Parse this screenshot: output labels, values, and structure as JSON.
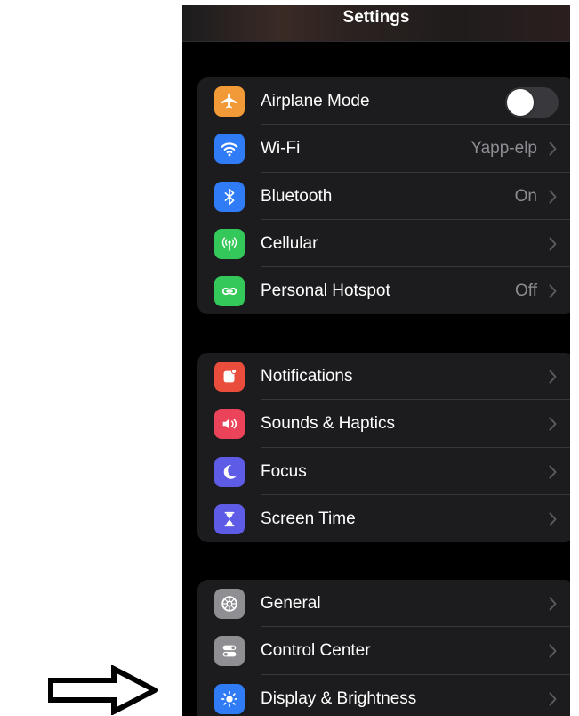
{
  "header": {
    "title": "Settings"
  },
  "groups": [
    {
      "rows": [
        {
          "label": "Airplane Mode",
          "icon": "airplane-icon",
          "color": "#f19a37",
          "control": "toggle",
          "toggle_on": false
        },
        {
          "label": "Wi-Fi",
          "icon": "wifi-icon",
          "color": "#2f7cf6",
          "value": "Yapp-elp"
        },
        {
          "label": "Bluetooth",
          "icon": "bluetooth-icon",
          "color": "#2f7cf6",
          "value": "On"
        },
        {
          "label": "Cellular",
          "icon": "cellular-icon",
          "color": "#34c759"
        },
        {
          "label": "Personal Hotspot",
          "icon": "hotspot-icon",
          "color": "#34c759",
          "value": "Off"
        }
      ]
    },
    {
      "rows": [
        {
          "label": "Notifications",
          "icon": "notifications-icon",
          "color": "#eb4d3d"
        },
        {
          "label": "Sounds & Haptics",
          "icon": "sounds-icon",
          "color": "#eb445a"
        },
        {
          "label": "Focus",
          "icon": "moon-icon",
          "color": "#5e5ce6"
        },
        {
          "label": "Screen Time",
          "icon": "hourglass-icon",
          "color": "#5e5ce6"
        }
      ]
    },
    {
      "rows": [
        {
          "label": "General",
          "icon": "gear-icon",
          "color": "#8e8e93"
        },
        {
          "label": "Control Center",
          "icon": "toggles-icon",
          "color": "#8e8e93"
        },
        {
          "label": "Display & Brightness",
          "icon": "sun-icon",
          "color": "#2f7cf6"
        }
      ]
    }
  ]
}
